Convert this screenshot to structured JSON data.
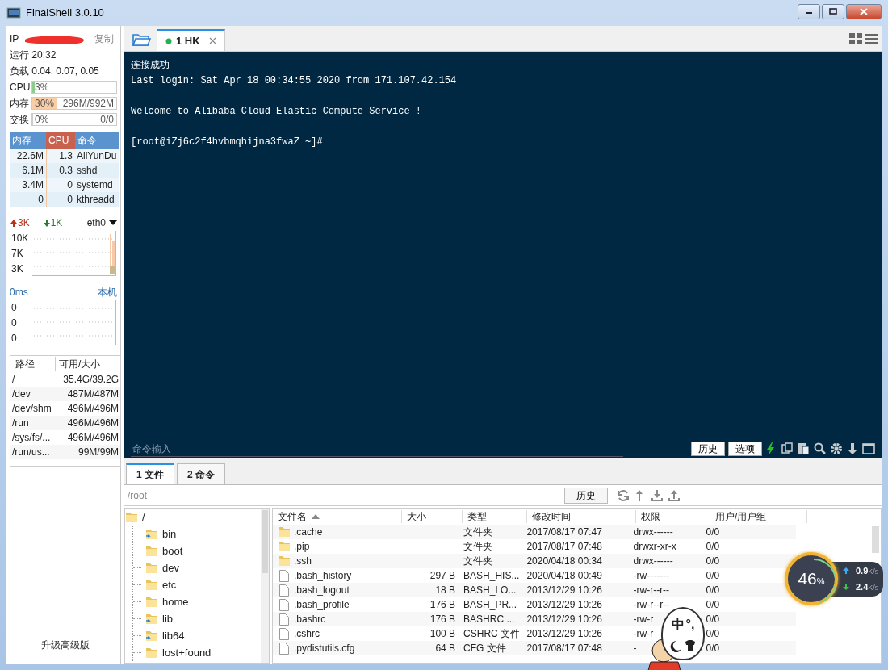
{
  "window": {
    "title": "FinalShell 3.0.10"
  },
  "sidebar": {
    "ip_label": "IP",
    "copy_button": "复制",
    "uptime": "运行 20:32",
    "load": "负载 0.04, 0.07, 0.05",
    "meters": [
      {
        "label": "CPU",
        "reading": "3%",
        "level": 0.03,
        "color": "#8fca8f"
      },
      {
        "label": "内存",
        "reading": "30%",
        "detail": "296M/992M",
        "level": 0.3,
        "color": "#f9cda6"
      },
      {
        "label": "交换",
        "reading": "0%",
        "detail": "0/0",
        "level": 0
      }
    ],
    "process_table": {
      "columns": [
        {
          "label": "内存",
          "sorted": false
        },
        {
          "label": "CPU",
          "sorted": true
        },
        {
          "label": "命令",
          "sorted": false
        }
      ],
      "rows": [
        [
          "22.6M",
          "1.3",
          "AliYunDu"
        ],
        [
          "6.1M",
          "0.3",
          "sshd"
        ],
        [
          "3.4M",
          "0",
          "systemd"
        ],
        [
          "0",
          "0",
          "kthreadd"
        ]
      ]
    },
    "network": {
      "up": "3K",
      "down": "1K",
      "interface": "eth0",
      "yticks": [
        "10K",
        "7K",
        "3K"
      ]
    },
    "ping": {
      "latency": "0ms",
      "target": "本机",
      "yticks": [
        "0",
        "0",
        "0"
      ]
    },
    "disks": {
      "columns": [
        "路径",
        "可用/大小"
      ],
      "rows": [
        [
          "/",
          "35.4G/39.2G"
        ],
        [
          "/dev",
          "487M/487M"
        ],
        [
          "/dev/shm",
          "496M/496M"
        ],
        [
          "/run",
          "496M/496M"
        ],
        [
          "/sys/fs/...",
          "496M/496M"
        ],
        [
          "/run/us...",
          "99M/99M"
        ]
      ]
    },
    "upgrade_link": "升级高级版"
  },
  "session_tabs": [
    {
      "label": "1 HK",
      "selected": true,
      "connected": true
    }
  ],
  "terminal": {
    "blocks": [
      [
        "连接成功",
        "Last login: Sat Apr 18 00:34:55 2020 from 171.107.42.154"
      ],
      [
        "Welcome to Alibaba Cloud Elastic Compute Service !"
      ],
      [
        "[root@iZj6c2f4hvbmqhijna3fwaZ ~]#"
      ]
    ],
    "command_placeholder": "命令输入",
    "buttons": [
      "历史",
      "选项"
    ]
  },
  "bottom_tabs": [
    {
      "label": "1 文件",
      "selected": true
    },
    {
      "label": "2 命令",
      "selected": false
    }
  ],
  "path_bar": {
    "placeholder": "/root",
    "button": "历史"
  },
  "folder_tree": {
    "name": "/",
    "children": [
      {
        "name": "bin",
        "kind": "link"
      },
      {
        "name": "boot",
        "kind": "folder"
      },
      {
        "name": "dev",
        "kind": "folder"
      },
      {
        "name": "etc",
        "kind": "folder"
      },
      {
        "name": "home",
        "kind": "folder"
      },
      {
        "name": "lib",
        "kind": "link"
      },
      {
        "name": "lib64",
        "kind": "link"
      },
      {
        "name": "lost+found",
        "kind": "folder"
      }
    ]
  },
  "file_table": {
    "columns": [
      {
        "label": "文件名",
        "sorted": true
      },
      {
        "label": "大小",
        "sorted": false
      },
      {
        "label": "类型",
        "sorted": false
      },
      {
        "label": "修改时间",
        "sorted": false
      },
      {
        "label": "权限",
        "sorted": false
      },
      {
        "label": "用户/用户组",
        "sorted": false
      }
    ],
    "rows": [
      {
        "kind": "folder",
        "name": ".cache",
        "type": "文件夹",
        "modified": "2017/08/17 07:47",
        "perms": "drwx------",
        "owner": "0/0"
      },
      {
        "kind": "folder",
        "name": ".pip",
        "type": "文件夹",
        "modified": "2017/08/17 07:48",
        "perms": "drwxr-xr-x",
        "owner": "0/0"
      },
      {
        "kind": "folder",
        "name": ".ssh",
        "type": "文件夹",
        "modified": "2020/04/18 00:34",
        "perms": "drwx------",
        "owner": "0/0"
      },
      {
        "kind": "file",
        "name": ".bash_history",
        "size": "297 B",
        "type": "BASH_HIS...",
        "modified": "2020/04/18 00:49",
        "perms": "-rw-------",
        "owner": "0/0"
      },
      {
        "kind": "file",
        "name": ".bash_logout",
        "size": "18 B",
        "type": "BASH_LO...",
        "modified": "2013/12/29 10:26",
        "perms": "-rw-r--r--",
        "owner": "0/0"
      },
      {
        "kind": "file",
        "name": ".bash_profile",
        "size": "176 B",
        "type": "BASH_PR...",
        "modified": "2013/12/29 10:26",
        "perms": "-rw-r--r--",
        "owner": "0/0"
      },
      {
        "kind": "file",
        "name": ".bashrc",
        "size": "176 B",
        "type": "BASHRC ...",
        "modified": "2013/12/29 10:26",
        "perms": "-rw-r",
        "owner": "0/0"
      },
      {
        "kind": "file",
        "name": ".cshrc",
        "size": "100 B",
        "type": "CSHRC 文件",
        "modified": "2013/12/29 10:26",
        "perms": "-rw-r",
        "owner": "0/0"
      },
      {
        "kind": "file",
        "name": ".pydistutils.cfg",
        "size": "64 B",
        "type": "CFG 文件",
        "modified": "2017/08/17 07:48",
        "perms": "-",
        "owner": "0/0"
      }
    ]
  },
  "speed_widget": {
    "percent": "46",
    "unit": "%",
    "level": 0.46,
    "up": "0.9",
    "up_unit": "K/s",
    "down": "2.4",
    "down_unit": "K/s"
  },
  "input_method": {
    "mode": "中",
    "punctuation": "°,"
  }
}
